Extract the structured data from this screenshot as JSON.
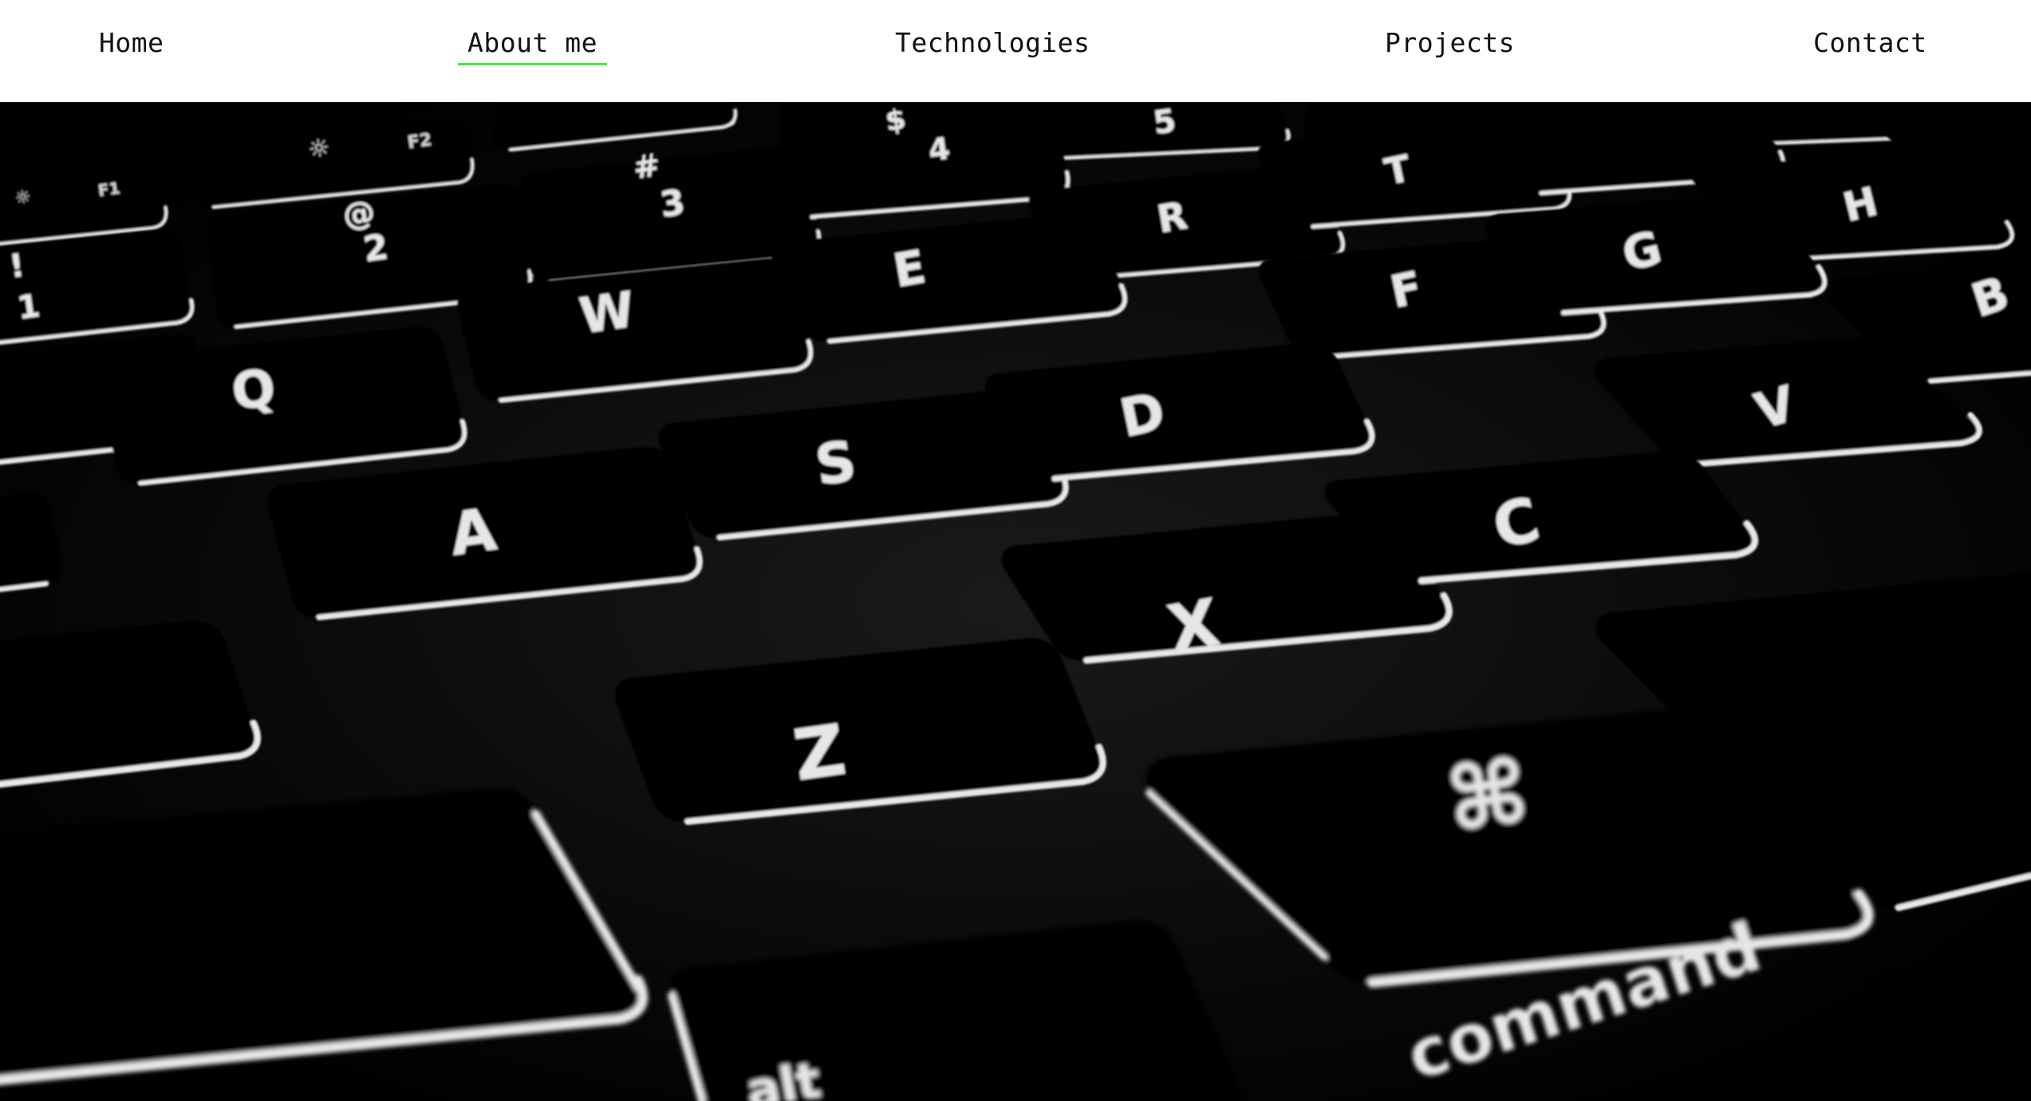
{
  "nav": {
    "items": [
      {
        "label": "Home",
        "active": false
      },
      {
        "label": "About me",
        "active": true
      },
      {
        "label": "Technologies",
        "active": false
      },
      {
        "label": "Projects",
        "active": false
      },
      {
        "label": "Contact",
        "active": false
      }
    ],
    "active_underline_color": "#4be34b"
  },
  "hero": {
    "image": "backlit-keyboard-photo",
    "keys": {
      "f1": "F1",
      "f2": "F2",
      "at": "@",
      "two": "2",
      "hash": "#",
      "three": "3",
      "dollar": "$",
      "four": "4",
      "r": "R",
      "t": "T",
      "g": "G",
      "h": "H",
      "b": "B",
      "w": "W",
      "e": "E",
      "q": "Q",
      "a": "A",
      "s": "S",
      "d": "D",
      "f": "F",
      "z": "Z",
      "x": "X",
      "c": "C",
      "v": "V",
      "cmd_symbol": "⌘",
      "command": "command",
      "alt": "alt"
    }
  }
}
